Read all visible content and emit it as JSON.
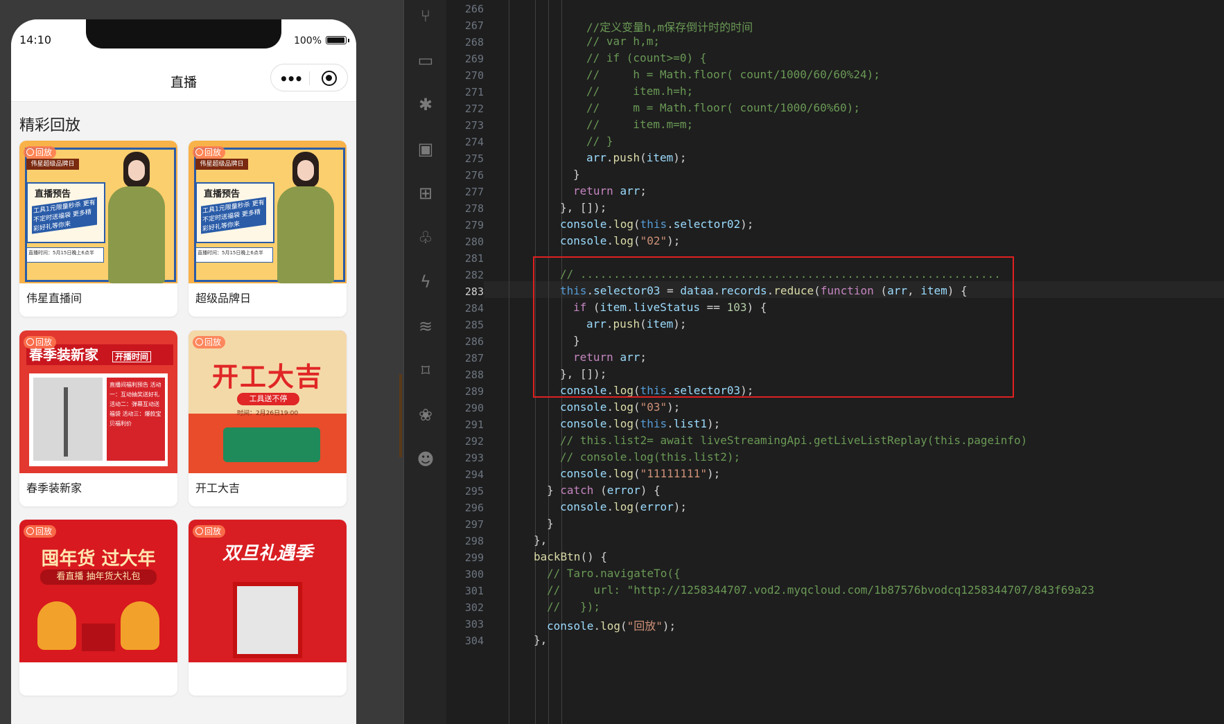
{
  "phone": {
    "time": "14:10",
    "battery": "100%",
    "nav_title": "直播",
    "section_title": "精彩回放",
    "replay_tag": "回放",
    "cards": [
      {
        "label": "伟星直播间"
      },
      {
        "label": "超级品牌日"
      },
      {
        "label": "春季装新家"
      },
      {
        "label": "开工大吉"
      },
      {
        "label": ""
      },
      {
        "label": ""
      }
    ],
    "posters": {
      "brand_banner": "伟星超级品牌日",
      "preview_title": "直播预告",
      "preview_sub": "工具1元限量秒杀 更有不定时送福袋 更多精彩好礼等你来",
      "preview_time": "直播时间：5月15日晚上6点半",
      "spring_title": "春季装新家",
      "spring_badge": "开播时间",
      "spring_list": "直播间福利预告 活动一：互动抽奖送好礼 活动二：弹幕互动送福袋 活动三：爆款宝贝福利价",
      "kaigong_title": "开工大吉",
      "kaigong_pill": "工具送不停",
      "kaigong_time": "时间：2月26日19:00",
      "newyear_title": "囤年货 过大年",
      "newyear_sub": "看直播 抽年货大礼包",
      "double_title": "双旦礼遇季"
    }
  },
  "editor": {
    "activity_icons": [
      "source-control-icon",
      "explorer-icon",
      "debug-icon",
      "remote-explorer-icon",
      "extensions-icon",
      "git-tree-icon",
      "lightning-icon",
      "docker-icon",
      "bookmark-icon",
      "paw-icon",
      "robot-icon"
    ],
    "lines": [
      {
        "n": "266",
        "text": ""
      },
      {
        "n": "267",
        "text": "//定义变量h,m保存倒计时的时间"
      },
      {
        "n": "268",
        "text": "// var h,m;"
      },
      {
        "n": "269",
        "text": "// if (count>=0) {"
      },
      {
        "n": "270",
        "text": "//     h = Math.floor( count/1000/60/60%24);"
      },
      {
        "n": "271",
        "text": "//     item.h=h;"
      },
      {
        "n": "272",
        "text": "//     m = Math.floor( count/1000/60%60);"
      },
      {
        "n": "273",
        "text": "//     item.m=m;"
      },
      {
        "n": "274",
        "text": "// }"
      },
      {
        "n": "275",
        "text": "arr.push(item);"
      },
      {
        "n": "276",
        "text": "}"
      },
      {
        "n": "277",
        "text": "return arr;"
      },
      {
        "n": "278",
        "text": "}, []);"
      },
      {
        "n": "279",
        "text": "console.log(this.selector02);"
      },
      {
        "n": "280",
        "text": "console.log(\"02\");"
      },
      {
        "n": "281",
        "text": ""
      },
      {
        "n": "282",
        "text": "// ..............................................................."
      },
      {
        "n": "283",
        "text": "this.selector03 = dataa.records.reduce(function (arr, item) {"
      },
      {
        "n": "284",
        "text": "if (item.liveStatus == 103) {"
      },
      {
        "n": "285",
        "text": "arr.push(item);"
      },
      {
        "n": "286",
        "text": "}"
      },
      {
        "n": "287",
        "text": "return arr;"
      },
      {
        "n": "288",
        "text": "}, []);"
      },
      {
        "n": "289",
        "text": "console.log(this.selector03);"
      },
      {
        "n": "290",
        "text": "console.log(\"03\");"
      },
      {
        "n": "291",
        "text": "console.log(this.list1);"
      },
      {
        "n": "292",
        "text": "// this.list2= await liveStreamingApi.getLiveListReplay(this.pageinfo)"
      },
      {
        "n": "293",
        "text": "// console.log(this.list2);"
      },
      {
        "n": "294",
        "text": "console.log(\"11111111\");"
      },
      {
        "n": "295",
        "text": "} catch (error) {"
      },
      {
        "n": "296",
        "text": "console.log(error);"
      },
      {
        "n": "297",
        "text": "}"
      },
      {
        "n": "298",
        "text": "},"
      },
      {
        "n": "299",
        "text": "backBtn() {"
      },
      {
        "n": "300",
        "text": "// Taro.navigateTo({"
      },
      {
        "n": "301",
        "text": "//     url: \"http://1258344707.vod2.myqcloud.com/1b87576bvodcq1258344707/843f69a23"
      },
      {
        "n": "302",
        "text": "//   });"
      },
      {
        "n": "303",
        "text": "console.log(\"回放\");"
      },
      {
        "n": "304",
        "text": "},"
      }
    ],
    "active_line": "283"
  }
}
